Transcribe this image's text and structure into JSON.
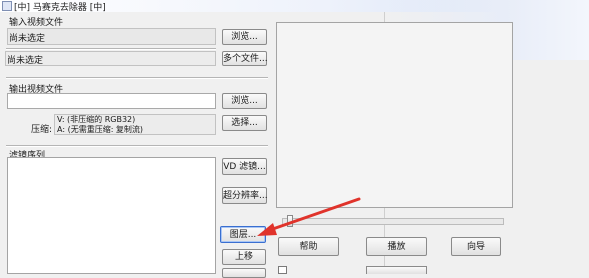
{
  "window": {
    "title": "[中] 马赛克去除器 [中]"
  },
  "input_section": {
    "heading": "输入视频文件",
    "file_value": "尚未选定",
    "multi_value": "尚未选定",
    "browse_label": "浏览...",
    "multi_file_label": "多个文件..."
  },
  "output_section": {
    "heading": "输出视频文件",
    "file_value": "",
    "browse_label": "浏览...",
    "compression_label": "压缩:",
    "video_codec": "V: (非压缩的 RGB32)",
    "audio_codec": "A: (无需重压缩: 复制流)",
    "choose_label": "选择..."
  },
  "filter_section": {
    "heading": "滤镜序列",
    "vd_filter_label": "VD 滤镜...",
    "super_res_label": "超分辨率...",
    "mosaic_label": "图层...",
    "up_label": "上移",
    "down_label": ""
  },
  "preview_panel": {
    "help_label": "帮助",
    "play_label": "播放",
    "wizard_label": "向导",
    "slider_position": 0.02
  },
  "annotation": {
    "arrow_color": "#e0332b"
  }
}
